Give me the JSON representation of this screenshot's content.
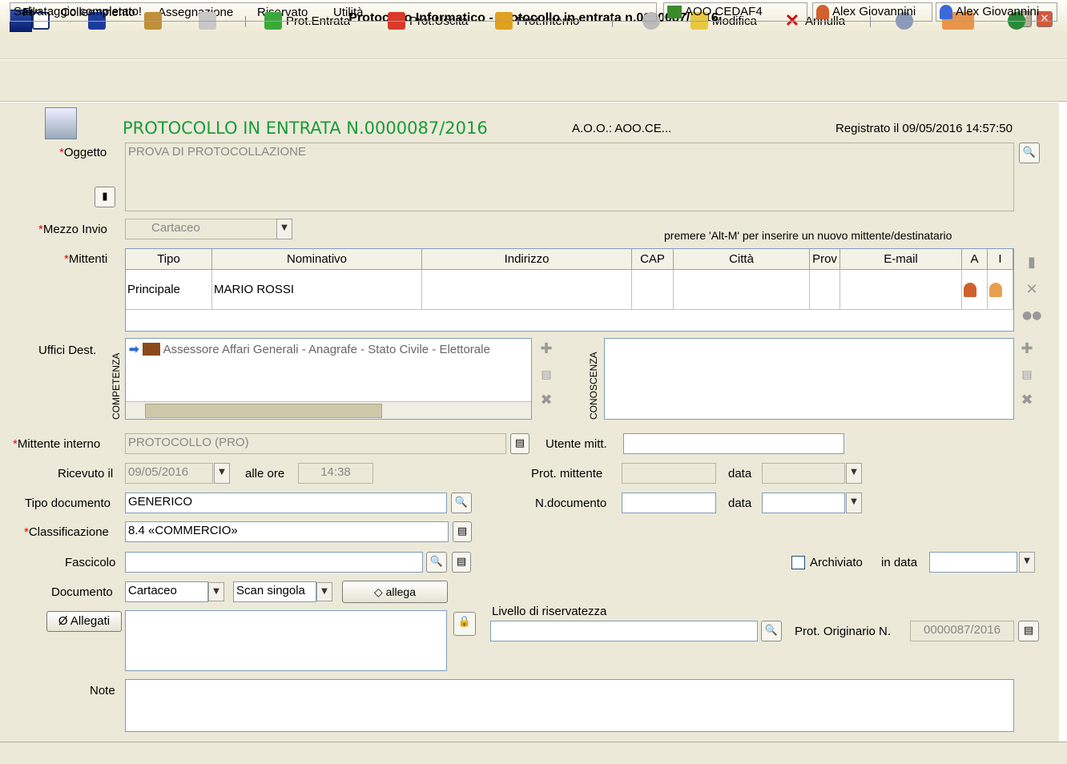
{
  "window": {
    "title": "Protocollo Informatico - Protocollo in entrata n.0000087/2016"
  },
  "menu": [
    "File",
    "Collegamento",
    "Assegnazione",
    "Riservato",
    "Utilità"
  ],
  "toolbar": {
    "prot_entrata": "Prot.Entrata",
    "prot_uscita": "Prot.Uscita",
    "prot_interno": "Prot.Interno",
    "modifica": "Modifica",
    "annulla": "Annulla"
  },
  "header": {
    "heading": "PROTOCOLLO IN ENTRATA N.0000087/2016",
    "aoo": "A.O.O.: AOO.CE...",
    "registrato": "Registrato il  09/05/2016 14:57:50"
  },
  "labels": {
    "oggetto": "Oggetto",
    "mezzo_invio": "Mezzo Invio",
    "mittenti": "Mittenti",
    "uffici_dest": "Uffici Dest.",
    "competenza": "COMPETENZA",
    "conoscenza": "CONOSCENZA",
    "mittente_interno": "Mittente interno",
    "utente_mitt": "Utente mitt.",
    "ricevuto_il": "Ricevuto il",
    "alle_ore": "alle ore",
    "prot_mittente": "Prot. mittente",
    "data": "data",
    "tipo_documento": "Tipo documento",
    "n_documento": "N.documento",
    "classificazione": "Classificazione",
    "fascicolo": "Fascicolo",
    "archiviato": "Archiviato",
    "in_data": "in data",
    "documento": "Documento",
    "allega": "allega",
    "allegati": "Allegati",
    "livello_riservatezza": "Livello di riservatezza",
    "prot_originario": "Prot. Originario N.",
    "note": "Note",
    "hint": "premere 'Alt-M' per inserire un nuovo mittente/destinatario"
  },
  "values": {
    "oggetto": "PROVA DI PROTOCOLLAZIONE",
    "mezzo_invio": "Cartaceo",
    "ufficio_competenza": "Assessore Affari Generali - Anagrafe - Stato Civile - Elettorale",
    "mittente_interno": "PROTOCOLLO (PRO)",
    "ricevuto_il": "09/05/2016",
    "alle_ore": "14:38",
    "tipo_documento": "GENERICO",
    "classificazione": "8.4 «COMMERCIO»",
    "documento": "Cartaceo",
    "scan": "Scan singola",
    "prot_originario": "0000087/2016"
  },
  "grid": {
    "columns": [
      "Tipo",
      "Nominativo",
      "Indirizzo",
      "CAP",
      "Città",
      "Prov",
      "E-mail",
      "A",
      "I"
    ],
    "rows": [
      [
        "Principale",
        "MARIO ROSSI",
        "",
        "",
        "",
        "",
        ""
      ]
    ]
  },
  "status": {
    "message": "Salvataggio completato!",
    "aoo": "AOO.CEDAF4",
    "user1": "Alex Giovannini",
    "user2": "Alex Giovannini"
  }
}
